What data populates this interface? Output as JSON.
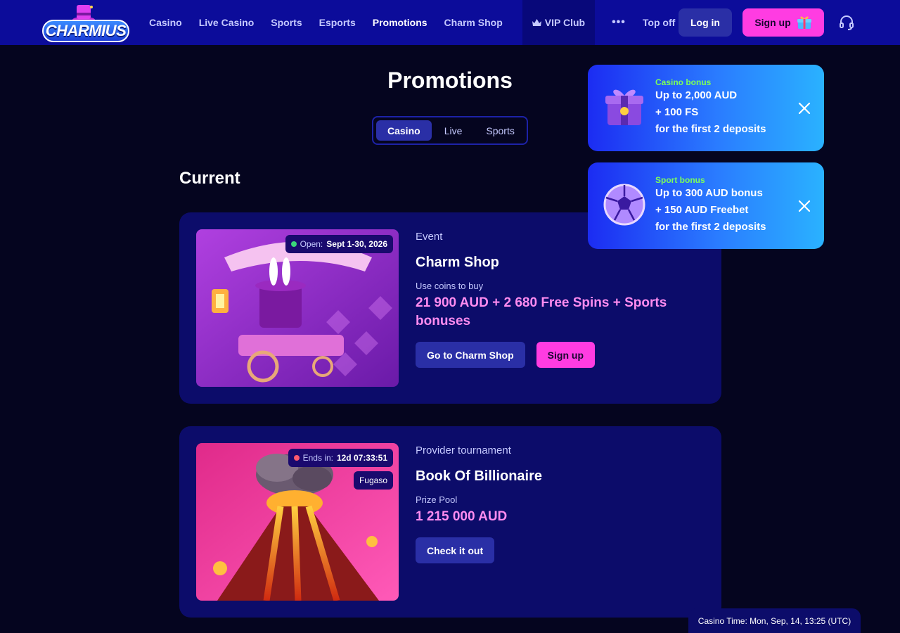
{
  "header": {
    "logo_text": "CHARMIUS",
    "nav": [
      "Casino",
      "Live Casino",
      "Sports",
      "Esports",
      "Promotions",
      "Charm Shop"
    ],
    "active_nav": "Promotions",
    "vip": "VIP Club",
    "more": "•••",
    "top_off": "Top off",
    "login": "Log in",
    "signup": "Sign up"
  },
  "page": {
    "title": "Promotions",
    "tabs": [
      "Casino",
      "Live",
      "Sports"
    ],
    "active_tab": "Casino",
    "section_title": "Current"
  },
  "promos": [
    {
      "status_label": "Open:",
      "status_value": "Sept 1-30, 2026",
      "status_color": "#3ad67a",
      "type": "Event",
      "name": "Charm Shop",
      "sub": "Use coins to buy",
      "highlight": "21 900 AUD + 2 680 Free Spins + Sports bonuses",
      "primary_btn": "Go to Charm Shop",
      "secondary_btn": "Sign up"
    },
    {
      "status_label": "Ends in:",
      "status_value": "12d 07:33:51",
      "status_color": "#ff5a6e",
      "provider": "Fugaso",
      "type": "Provider tournament",
      "name": "Book Of Billionaire",
      "sub": "Prize Pool",
      "highlight": "1 215 000 AUD",
      "primary_btn": "Check it out"
    }
  ],
  "bonuses": [
    {
      "kind": "Casino bonus",
      "lines": [
        "Up to 2,000 AUD",
        "+ 100 FS",
        "for the first 2 deposits"
      ],
      "icon": "gift-box-icon"
    },
    {
      "kind": "Sport bonus",
      "lines": [
        "Up to 300 AUD bonus",
        "+ 150 AUD Freebet",
        "for the first 2 deposits"
      ],
      "icon": "soccer-ball-icon"
    }
  ],
  "footer": {
    "casino_time": "Casino Time: Mon, Sep, 14, 13:25 (UTC)"
  },
  "colors": {
    "background": "#05051f",
    "header": "#0c0c9a",
    "card": "#0c0c6a",
    "accent_pink": "#ff3ce2",
    "accent_highlight": "#ff8cf0",
    "button_blue": "#2a2fa6",
    "bonus_kind_green": "#7dff5a"
  }
}
